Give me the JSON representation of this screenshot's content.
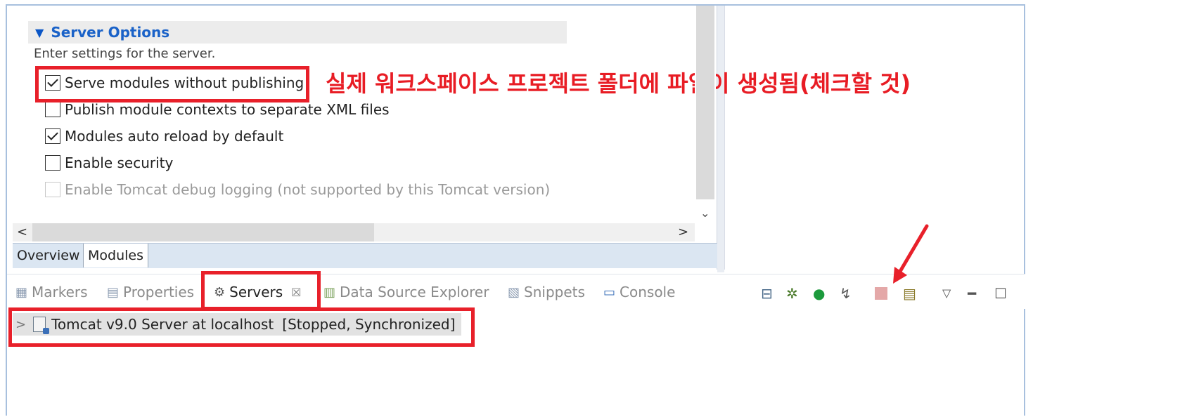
{
  "editor": {
    "section_title": "Server Options",
    "description": "Enter settings for the server.",
    "options": [
      {
        "label": "Serve modules without publishing",
        "checked": true,
        "enabled": true
      },
      {
        "label": "Publish module contexts to separate XML files",
        "checked": false,
        "enabled": true
      },
      {
        "label": "Modules auto reload by default",
        "checked": true,
        "enabled": true
      },
      {
        "label": "Enable security",
        "checked": false,
        "enabled": true
      },
      {
        "label": "Enable Tomcat debug logging (not supported by this Tomcat version)",
        "checked": false,
        "enabled": false
      }
    ],
    "tabs": [
      "Overview",
      "Modules"
    ],
    "active_tab": "Modules"
  },
  "annotation": {
    "text": "실제 워크스페이스 프로젝트 폴더에 파일이 생성됨(체크할 것)",
    "color": "#e81c24"
  },
  "views": {
    "tabs": [
      {
        "label": "Markers",
        "icon": "markers-icon"
      },
      {
        "label": "Properties",
        "icon": "properties-icon"
      },
      {
        "label": "Servers",
        "icon": "servers-icon",
        "active": true,
        "close": "☒"
      },
      {
        "label": "Data Source Explorer",
        "icon": "data-source-icon"
      },
      {
        "label": "Snippets",
        "icon": "snippets-icon"
      },
      {
        "label": "Console",
        "icon": "console-icon"
      }
    ],
    "toolbar_icons": [
      "collapse-all-icon",
      "debug-icon",
      "start-icon",
      "profile-icon",
      "stop-icon",
      "publish-icon",
      "view-menu-icon",
      "minimize-icon",
      "maximize-icon"
    ]
  },
  "servers": {
    "items": [
      {
        "name": "Tomcat v9.0 Server at localhost",
        "status": "[Stopped, Synchronized]"
      }
    ]
  },
  "colors": {
    "highlight": "#e8202a",
    "section_title": "#1a62c8"
  }
}
